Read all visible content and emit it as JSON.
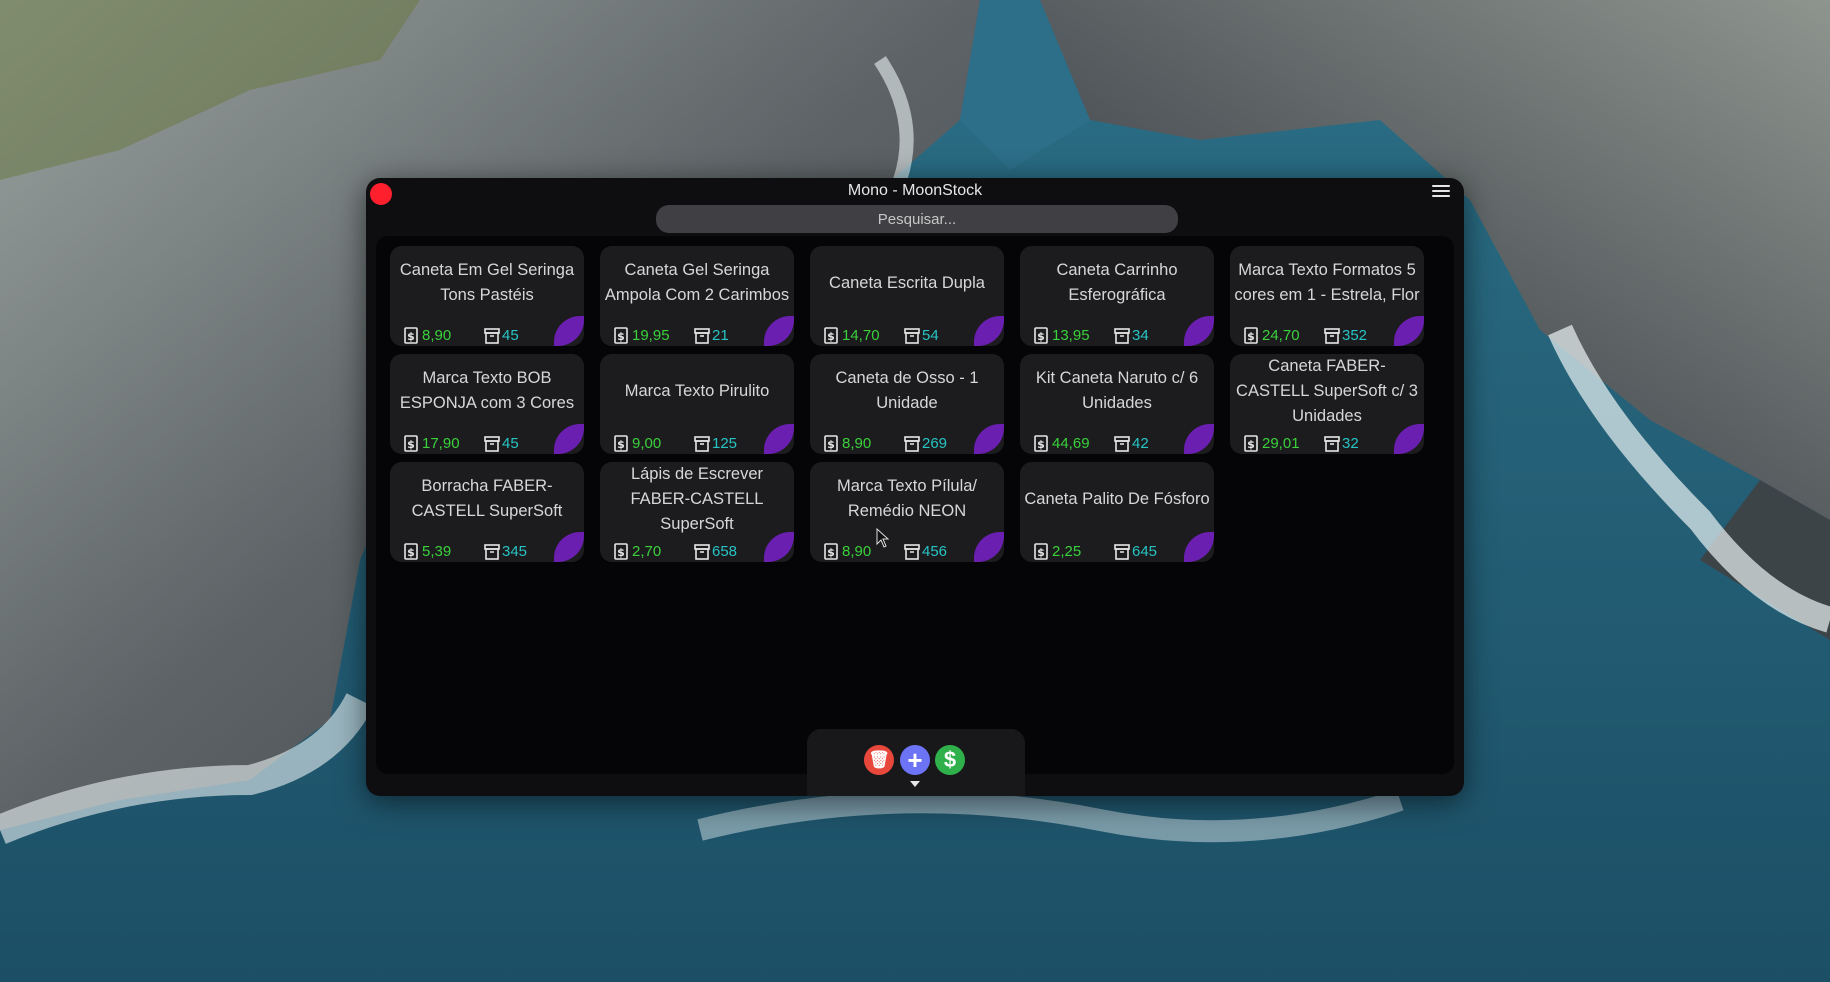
{
  "window": {
    "title": "Mono - MoonStock",
    "search_placeholder": "Pesquisar..."
  },
  "colors": {
    "price": "#3ad13a",
    "stock": "#27c4c4",
    "accent_leaf": "#6a1fb0",
    "close": "#ff1f2d",
    "delete": "#e8473b",
    "add": "#6c74f5",
    "sell": "#2fb04a"
  },
  "icons": {
    "price": "dollar-document-icon",
    "stock": "archive-box-icon",
    "close": "close-icon",
    "menu": "hamburger-menu-icon",
    "delete": "trash-icon",
    "add": "plus-icon",
    "sell": "dollar-icon",
    "collapse": "caret-down-icon"
  },
  "products": [
    {
      "name": "Caneta Em Gel Seringa Tons Pastéis",
      "price": "8,90",
      "stock": "45"
    },
    {
      "name": "Caneta Gel Seringa Ampola Com 2 Carimbos",
      "price": "19,95",
      "stock": "21"
    },
    {
      "name": "Caneta Escrita Dupla",
      "price": "14,70",
      "stock": "54"
    },
    {
      "name": "Caneta Carrinho Esferográfica",
      "price": "13,95",
      "stock": "34"
    },
    {
      "name": "Marca Texto Formatos 5 cores em 1 - Estrela, Flor",
      "price": "24,70",
      "stock": "352"
    },
    {
      "name": "Marca Texto BOB ESPONJA com 3 Cores",
      "price": "17,90",
      "stock": "45"
    },
    {
      "name": "Marca Texto Pirulito",
      "price": "9,00",
      "stock": "125"
    },
    {
      "name": "Caneta de Osso - 1 Unidade",
      "price": "8,90",
      "stock": "269"
    },
    {
      "name": "Kit Caneta Naruto c/ 6 Unidades",
      "price": "44,69",
      "stock": "42"
    },
    {
      "name": "Caneta FABER-CASTELL SuperSoft c/ 3 Unidades",
      "price": "29,01",
      "stock": "32"
    },
    {
      "name": "Borracha FABER-CASTELL SuperSoft",
      "price": "5,39",
      "stock": "345"
    },
    {
      "name": "Lápis de Escrever FABER-CASTELL SuperSoft",
      "price": "2,70",
      "stock": "658"
    },
    {
      "name": "Marca Texto Pílula/ Remédio NEON",
      "price": "8,90",
      "stock": "456"
    },
    {
      "name": "Caneta Palito De Fósforo",
      "price": "2,25",
      "stock": "645"
    }
  ],
  "toolbar": {
    "delete_symbol": "🗑",
    "add_symbol": "+",
    "sell_symbol": "$"
  }
}
